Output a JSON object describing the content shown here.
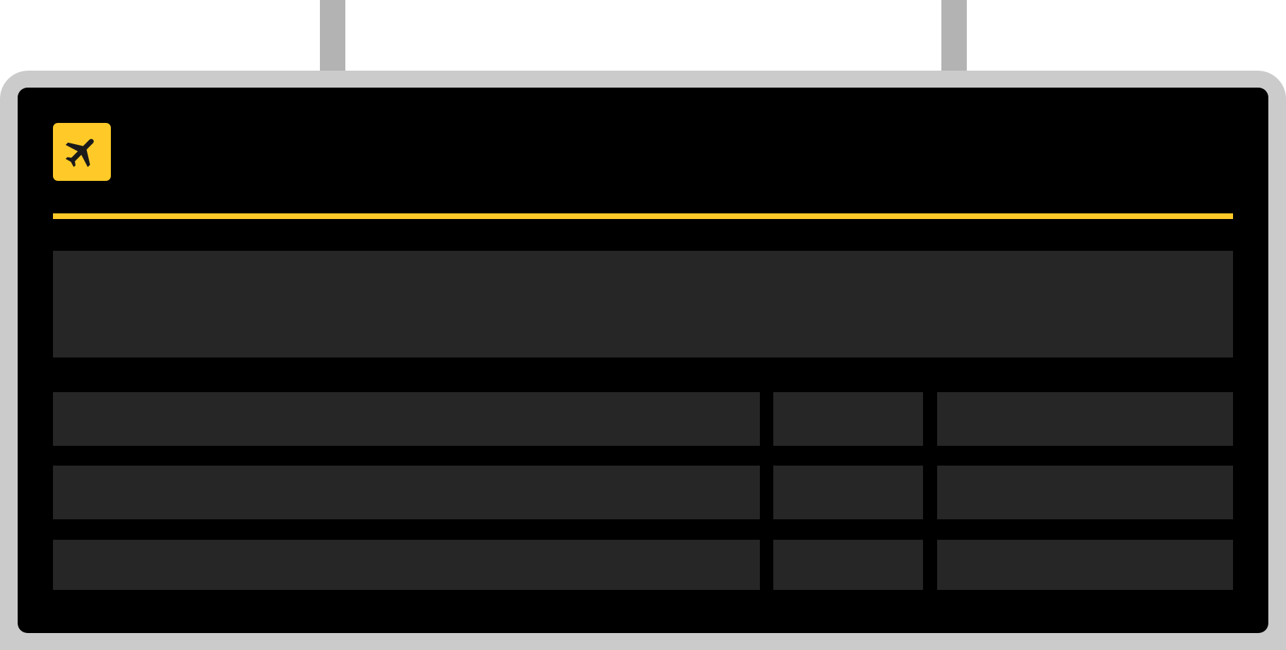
{
  "sign": {
    "icon": "airplane-icon",
    "colors": {
      "frame": "#cbcbcb",
      "hanger": "#b3b3b3",
      "board": "#000000",
      "panel": "#262626",
      "accent": "#ffca28",
      "icon_glyph": "#1a1a1a"
    },
    "headline": "",
    "rows": [
      {
        "destination": "",
        "time": "",
        "status": ""
      },
      {
        "destination": "",
        "time": "",
        "status": ""
      },
      {
        "destination": "",
        "time": "",
        "status": ""
      }
    ]
  }
}
